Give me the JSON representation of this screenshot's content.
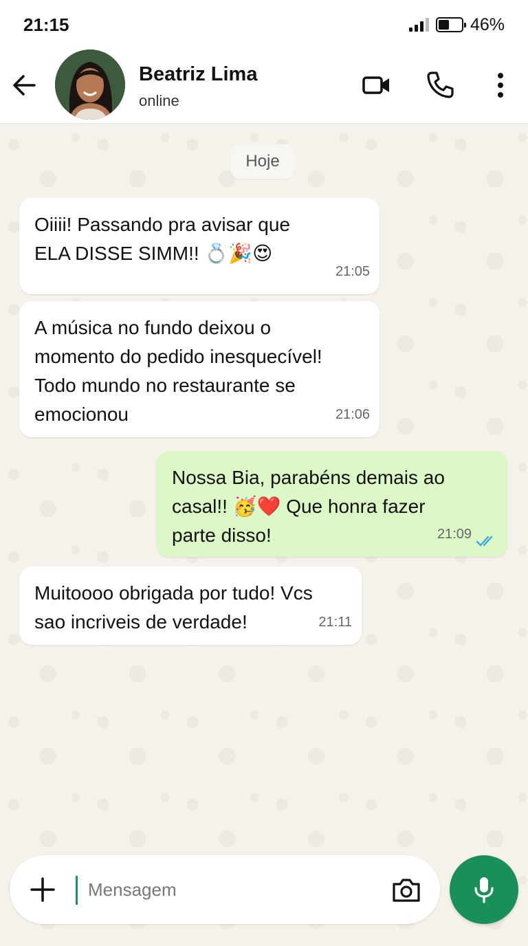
{
  "status_bar": {
    "time": "21:15",
    "battery_percent": "46%",
    "battery_level": 0.46
  },
  "header": {
    "contact_name": "Beatriz Lima",
    "contact_status": "online"
  },
  "chat": {
    "date_separator": "Hoje",
    "messages": [
      {
        "direction": "in",
        "text": "Oiiii! Passando pra avisar que\nELA DISSE SIMM!! 💍🎉😍",
        "time": "21:05"
      },
      {
        "direction": "in",
        "text": "A música no fundo deixou o\nmomento do pedido inesquecível!\nTodo mundo no restaurante se\nemocionou",
        "time": "21:06"
      },
      {
        "direction": "out",
        "text": "Nossa Bia, parabéns demais ao\ncasal!! 🥳❤️ Que honra fazer\nparte disso!",
        "time": "21:09",
        "status": "read"
      },
      {
        "direction": "in",
        "text": "Muitoooo obrigada por tudo! Vcs\nsao incriveis de verdade!",
        "time": "21:11"
      }
    ]
  },
  "composer": {
    "placeholder": "Mensagem"
  },
  "colors": {
    "outgoing_bubble": "#dcf8c6",
    "incoming_bubble": "#ffffff",
    "accent_green": "#1a8f5a",
    "read_ticks": "#34a7e0"
  }
}
